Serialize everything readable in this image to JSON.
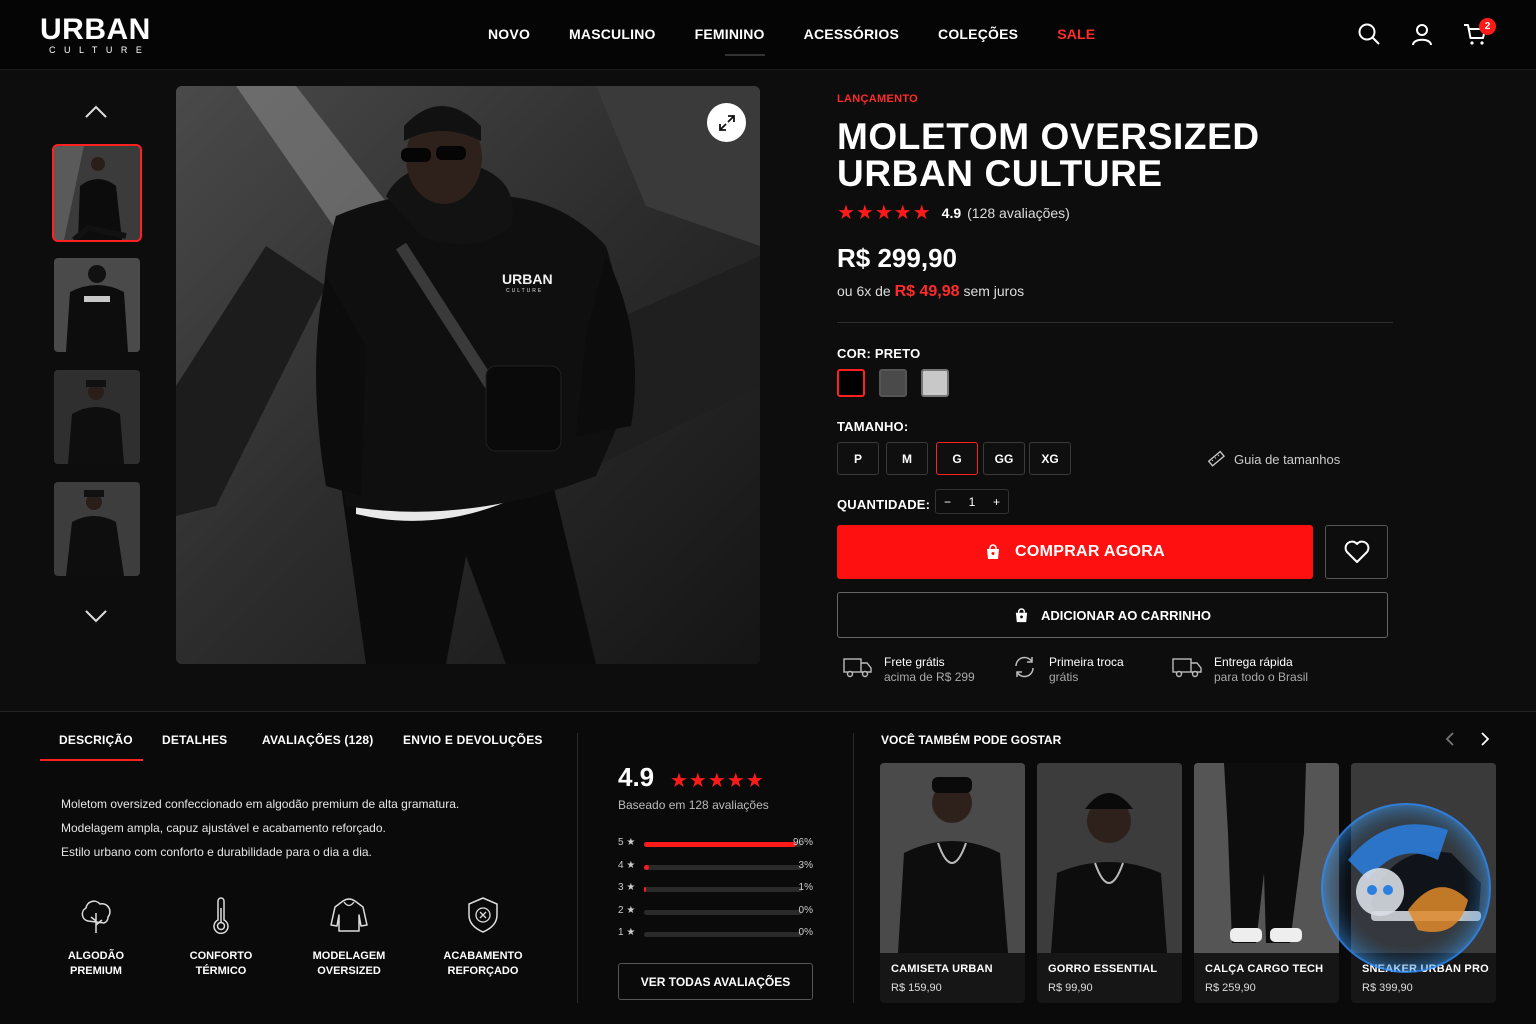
{
  "brand": {
    "name": "URBAN",
    "sub": "CULTURE"
  },
  "nav": {
    "items": [
      {
        "label": "NOVO"
      },
      {
        "label": "MASCULINO"
      },
      {
        "label": "FEMININO"
      },
      {
        "label": "ACESSÓRIOS"
      },
      {
        "label": "COLEÇÕES"
      },
      {
        "label": "SALE"
      }
    ],
    "cart_count": "2",
    "icons": [
      "search-icon",
      "user-icon",
      "cart-icon"
    ]
  },
  "product": {
    "badge": "LANÇAMENTO",
    "title_line1": "MOLETOM OVERSIZED",
    "title_line2": "URBAN CULTURE",
    "stars": "★★★★★",
    "rating": "4.9",
    "rating_count": "(128 avaliações)",
    "price": "R$ 299,90",
    "installments_prefix": "ou 6x de",
    "installments_value": "R$ 49,98",
    "installments_suffix": "sem juros",
    "color_label": "COR: PRETO",
    "colors": [
      "#000000",
      "#4a4a4a",
      "#c8c8c8"
    ],
    "size_label": "TAMANHO:",
    "sizes": [
      "P",
      "M",
      "G",
      "GG",
      "XG"
    ],
    "selected_size": "G",
    "size_guide": "Guia de tamanhos",
    "qty_label": "QUANTIDADE:",
    "qty_minus": "−",
    "qty_value": "1",
    "qty_plus": "+",
    "buy_now": "COMPRAR AGORA",
    "add_to_cart": "ADICIONAR AO CARRINHO",
    "image_print": "URBAN",
    "image_print_sub": "CULTURE"
  },
  "perks": [
    {
      "title": "Frete grátis",
      "sub": "acima de R$ 299",
      "icon": "truck-icon"
    },
    {
      "title": "Primeira troca",
      "sub": "grátis",
      "icon": "exchange-icon"
    },
    {
      "title": "Entrega rápida",
      "sub": "para todo o Brasil",
      "icon": "delivery-icon"
    }
  ],
  "tabs": [
    {
      "label": "DESCRIÇÃO"
    },
    {
      "label": "DETALHES"
    },
    {
      "label": "AVALIAÇÕES (128)"
    },
    {
      "label": "ENVIO E DEVOLUÇÕES"
    }
  ],
  "description": [
    "Moletom oversized confeccionado em algodão premium de alta gramatura.",
    "Modelagem ampla, capuz ajustável e acabamento reforçado.",
    "Estilo urbano com conforto e durabilidade para o dia a dia."
  ],
  "features": [
    {
      "l1": "ALGODÃO",
      "l2": "PREMIUM",
      "icon": "cotton-icon"
    },
    {
      "l1": "CONFORTO",
      "l2": "TÉRMICO",
      "icon": "thermometer-icon"
    },
    {
      "l1": "MODELAGEM",
      "l2": "OVERSIZED",
      "icon": "hoodie-icon"
    },
    {
      "l1": "ACABAMENTO",
      "l2": "REFORÇADO",
      "icon": "shield-icon"
    }
  ],
  "reviews": {
    "rating": "4.9",
    "stars": "★★★★★",
    "based_on": "Baseado em 128 avaliações",
    "bars": [
      {
        "label": "5 ★",
        "pct": "96%",
        "value": 96
      },
      {
        "label": "4 ★",
        "pct": "3%",
        "value": 3
      },
      {
        "label": "3 ★",
        "pct": "1%",
        "value": 1
      },
      {
        "label": "2 ★",
        "pct": "0%",
        "value": 0
      },
      {
        "label": "1 ★",
        "pct": "0%",
        "value": 0
      }
    ],
    "see_all": "VER TODAS AVALIAÇÕES"
  },
  "recommendations": {
    "title": "VOCÊ TAMBÉM PODE GOSTAR",
    "items": [
      {
        "name": "CAMISETA URBAN",
        "price": "R$ 159,90"
      },
      {
        "name": "GORRO ESSENTIAL",
        "price": "R$ 99,90"
      },
      {
        "name": "CALÇA CARGO TECH",
        "price": "R$ 259,90"
      },
      {
        "name": "SNEAKER URBAN PRO",
        "price": "R$ 399,90"
      }
    ]
  },
  "colors": {
    "accent": "#ff1a1a",
    "background": "#0d0d0d"
  }
}
